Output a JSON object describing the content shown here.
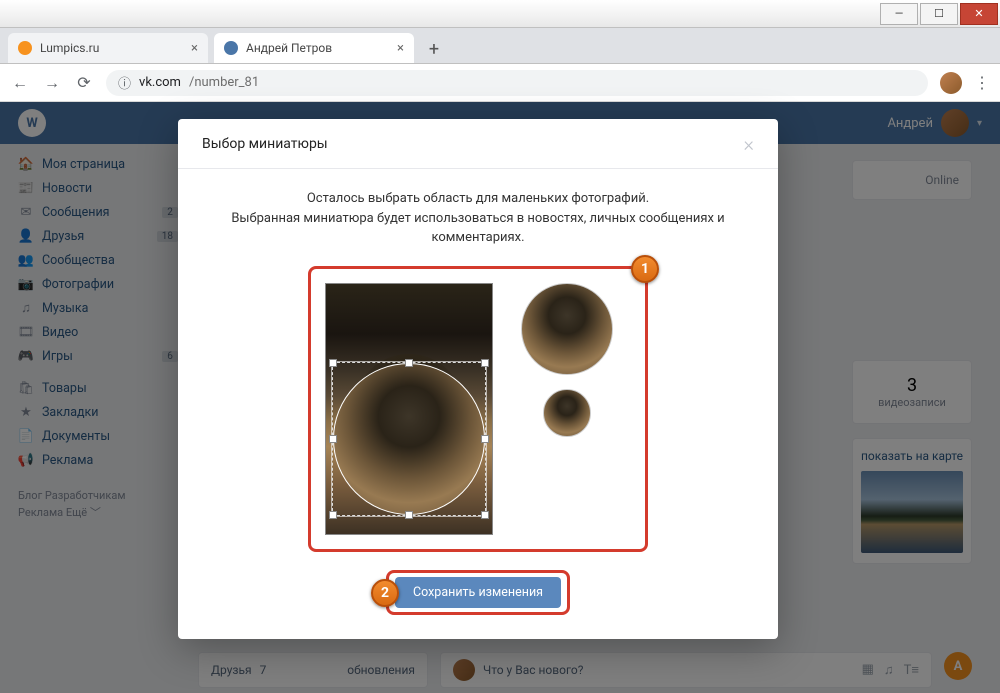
{
  "window": {
    "minimize": "—",
    "maximize": "☐",
    "close": "✕"
  },
  "tabs": [
    {
      "title": "Lumpics.ru",
      "favicon": "#f7921e"
    },
    {
      "title": "Андрей Петров",
      "favicon": "#4a76a8"
    }
  ],
  "address": {
    "domain": "vk.com",
    "path": "/number_81"
  },
  "vk": {
    "logo": "W",
    "username": "Андрей",
    "nav": [
      {
        "icon": "🏠",
        "label": "Моя страница",
        "badge": ""
      },
      {
        "icon": "📰",
        "label": "Новости",
        "badge": ""
      },
      {
        "icon": "✉",
        "label": "Сообщения",
        "badge": "2"
      },
      {
        "icon": "👤",
        "label": "Друзья",
        "badge": "18"
      },
      {
        "icon": "👥",
        "label": "Сообщества",
        "badge": ""
      },
      {
        "icon": "📷",
        "label": "Фотографии",
        "badge": ""
      },
      {
        "icon": "♫",
        "label": "Музыка",
        "badge": ""
      },
      {
        "icon": "🎞",
        "label": "Видео",
        "badge": ""
      },
      {
        "icon": "🎮",
        "label": "Игры",
        "badge": "6"
      },
      {
        "icon": "🛍",
        "label": "Товары",
        "badge": ""
      },
      {
        "icon": "★",
        "label": "Закладки",
        "badge": ""
      },
      {
        "icon": "📄",
        "label": "Документы",
        "badge": ""
      },
      {
        "icon": "📢",
        "label": "Реклама",
        "badge": ""
      }
    ],
    "footer": {
      "line1": "Блог   Разработчикам",
      "line2": "Реклама   Ещё ﹀"
    },
    "online": "Online",
    "stat": {
      "num": "3",
      "label": "видеозаписи"
    },
    "map_link": "показать на карте",
    "friends": {
      "label": "Друзья",
      "count": "7",
      "upd": "обновления"
    },
    "status_placeholder": "Что у Вас нового?",
    "corner": "A"
  },
  "modal": {
    "title": "Выбор миниатюры",
    "close": "×",
    "line1": "Осталось выбрать область для маленьких фотографий.",
    "line2": "Выбранная миниатюра будет использоваться в новостях, личных сообщениях и комментариях.",
    "save": "Сохранить изменения",
    "callout1": "1",
    "callout2": "2"
  }
}
